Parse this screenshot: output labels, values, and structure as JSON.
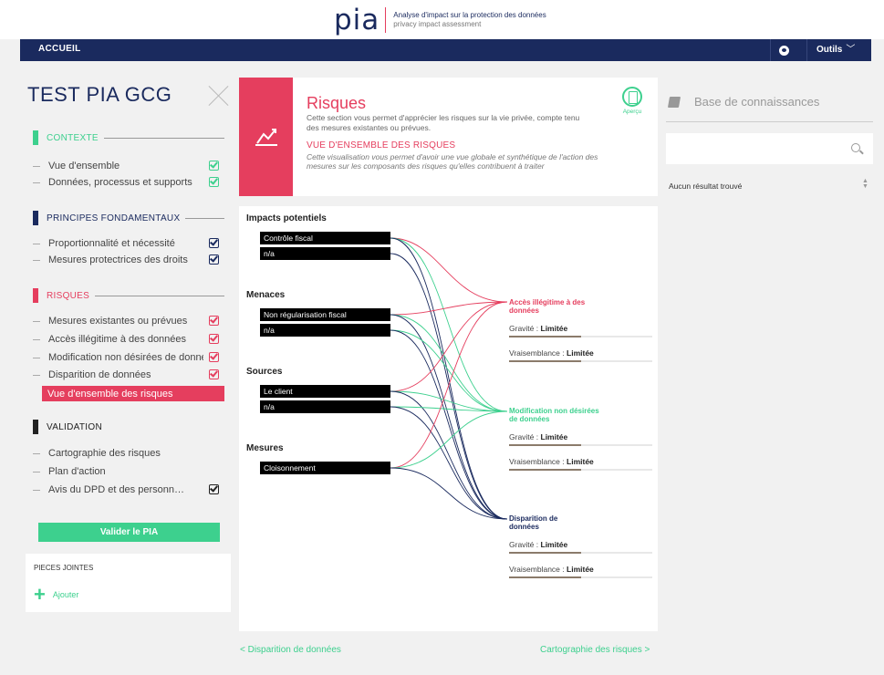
{
  "header": {
    "logo_word": "pia",
    "tagline": "Analyse d'impact sur la protection des données",
    "tagline_sub": "privacy impact assessment"
  },
  "nav": {
    "home": "ACCUEIL",
    "tools": "Outils"
  },
  "pia": {
    "title": "TEST PIA GCG"
  },
  "sidebar": {
    "sections": [
      {
        "label": "CONTEXTE",
        "color": "#3dd08e"
      },
      {
        "label": "PRINCIPES FONDAMENTAUX",
        "color": "#1a2a5e"
      },
      {
        "label": "RISQUES",
        "color": "#e53e5e"
      },
      {
        "label": "VALIDATION",
        "color": "#222222"
      }
    ],
    "items": [
      {
        "label": "Vue d'ensemble"
      },
      {
        "label": "Données, processus et supports"
      },
      {
        "label": "Proportionnalité et nécessité"
      },
      {
        "label": "Mesures protectrices des droits"
      },
      {
        "label": "Mesures existantes ou prévues"
      },
      {
        "label": "Accès illégitime à des données"
      },
      {
        "label": "Modification non désirées de données"
      },
      {
        "label": "Disparition de données"
      },
      {
        "label": "Vue d'ensemble des risques"
      },
      {
        "label": "Cartographie des risques"
      },
      {
        "label": "Plan d'action"
      },
      {
        "label": "Avis du DPD et des personnes concernées"
      }
    ],
    "validate_label": "Valider le PIA",
    "attachments_title": "PIECES JOINTES",
    "add_label": "Ajouter"
  },
  "section_header": {
    "title": "Risques",
    "description": "Cette section vous permet d'apprécier les risques sur la vie privée, compte tenu des mesures existantes ou prévues.",
    "subtitle": "VUE D'ENSEMBLE DES RISQUES",
    "subdescription": "Cette visualisation vous permet d'avoir une vue globale et synthétique de l'action des mesures sur les composants des risques qu'elles contribuent à traiter",
    "preview_label": "Aperçu"
  },
  "overview": {
    "groups": [
      {
        "title": "Impacts potentiels",
        "items": [
          "Contrôle fiscal",
          "n/a"
        ]
      },
      {
        "title": "Menaces",
        "items": [
          "Non régularisation fiscal",
          "n/a"
        ]
      },
      {
        "title": "Sources",
        "items": [
          "Le client",
          "n/a"
        ]
      },
      {
        "title": "Mesures",
        "items": [
          "Cloisonnement"
        ]
      }
    ],
    "risks": [
      {
        "title": "Accès illégitime à des données",
        "color": "#e53e5e",
        "gravity_label": "Gravité :",
        "gravity": "Limitée",
        "likelihood_label": "Vraisemblance :",
        "likelihood": "Limitée",
        "level": 0.5
      },
      {
        "title": "Modification non désirées de données",
        "color": "#3dd08e",
        "gravity_label": "Gravité :",
        "gravity": "Limitée",
        "likelihood_label": "Vraisemblance :",
        "likelihood": "Limitée",
        "level": 0.5
      },
      {
        "title": "Disparition de données",
        "color": "#1a2a5e",
        "gravity_label": "Gravité :",
        "gravity": "Limitée",
        "likelihood_label": "Vraisemblance :",
        "likelihood": "Limitée",
        "level": 0.5
      }
    ]
  },
  "pager": {
    "prev": "< Disparition de données",
    "next": "Cartographie des risques >"
  },
  "knowledge": {
    "title": "Base de connaissances",
    "search_placeholder": "",
    "empty": "Aucun résultat trouvé"
  },
  "colors": {
    "accent_red": "#e53e5e",
    "accent_green": "#3dd08e",
    "navy": "#1a2a5e"
  }
}
